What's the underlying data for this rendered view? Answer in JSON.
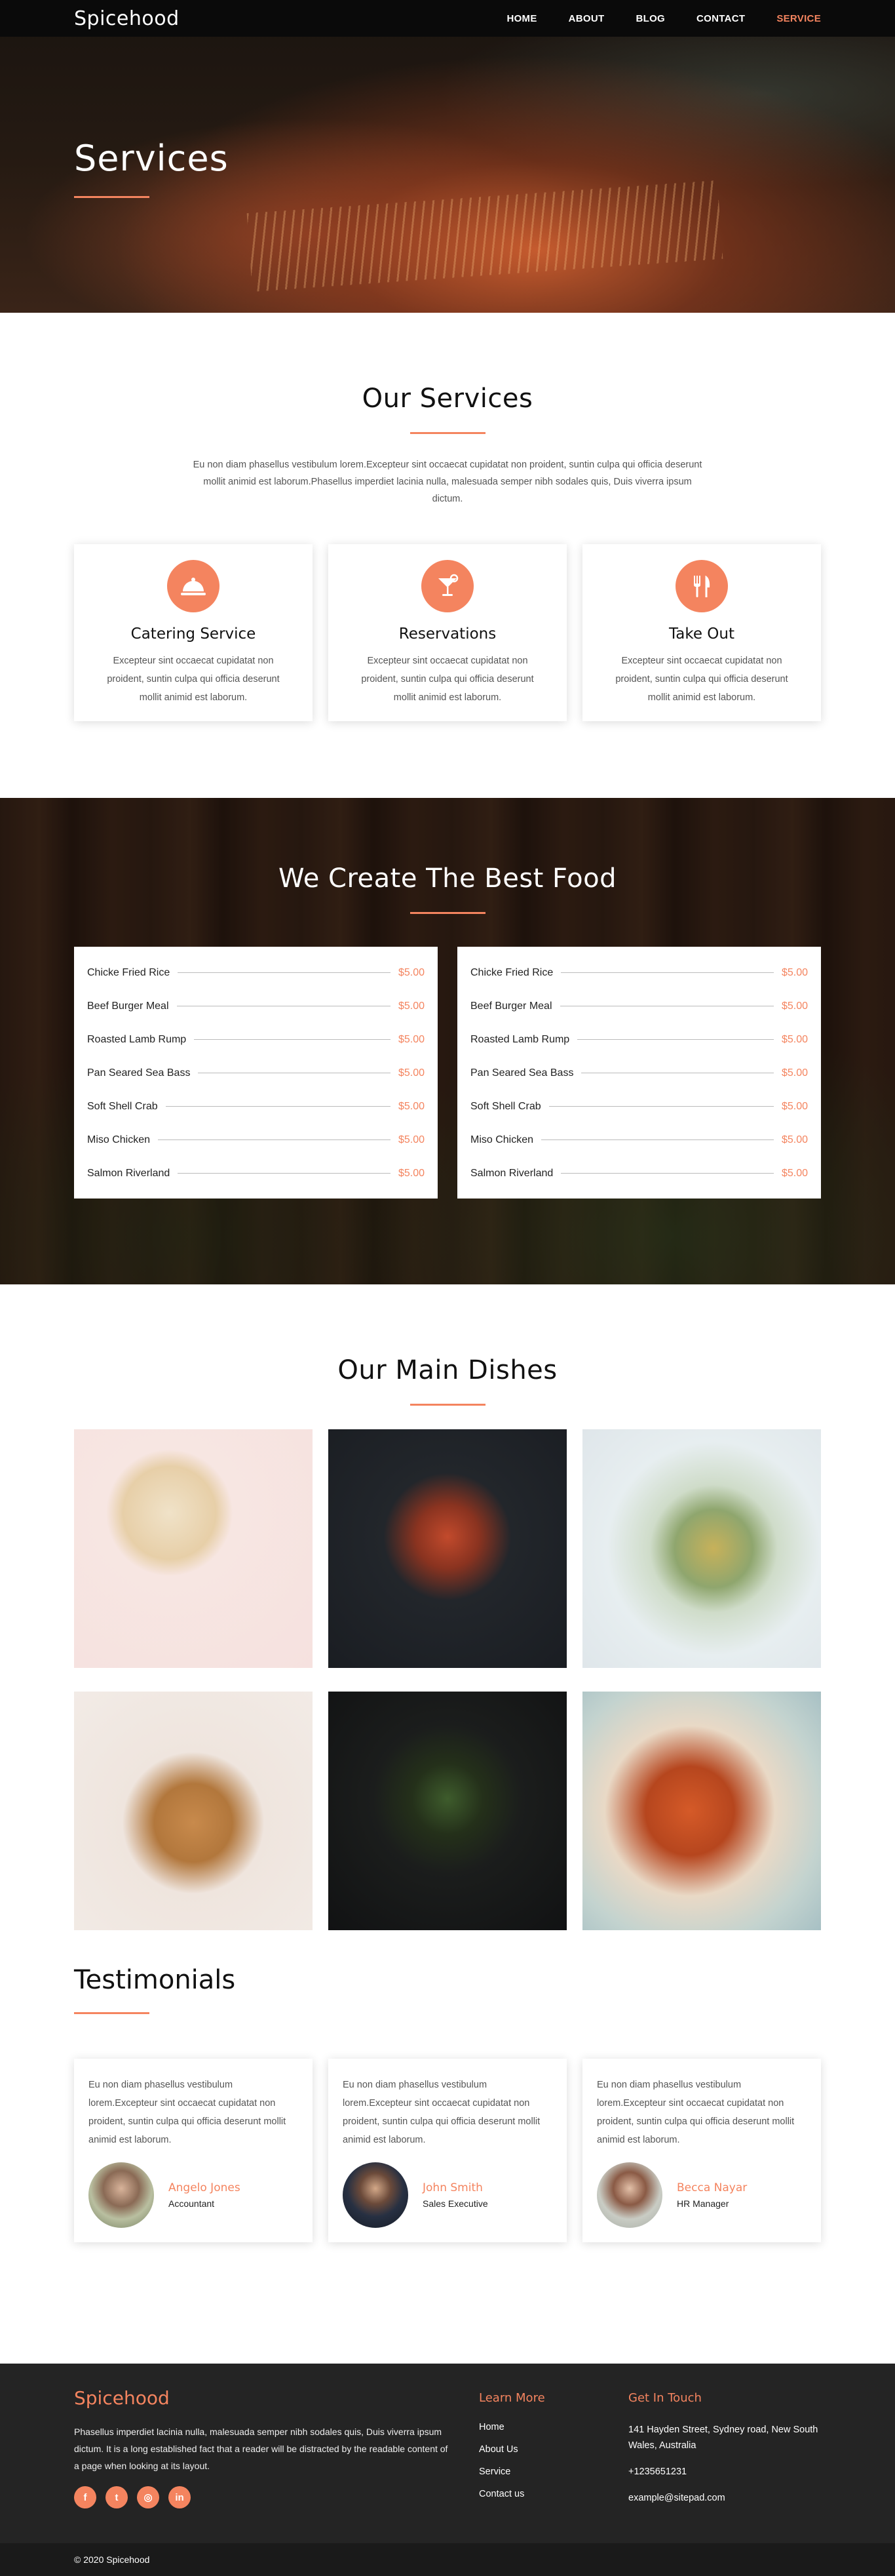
{
  "brand": "Spicehood",
  "nav": {
    "items": [
      {
        "label": "HOME",
        "active": false
      },
      {
        "label": "ABOUT",
        "active": false
      },
      {
        "label": "BLOG",
        "active": false
      },
      {
        "label": "CONTACT",
        "active": false
      },
      {
        "label": "SERVICE",
        "active": true
      }
    ]
  },
  "hero": {
    "title": "Services"
  },
  "services": {
    "title": "Our Services",
    "intro": "Eu non diam phasellus vestibulum lorem.Excepteur sint occaecat cupidatat non proident, suntin culpa qui officia deserunt mollit animid est laborum.Phasellus imperdiet lacinia nulla, malesuada semper nibh sodales quis, Duis viverra ipsum dictum.",
    "cards": [
      {
        "icon": "cloche-icon",
        "title": "Catering Service",
        "text": "Excepteur sint occaecat cupidatat non proident, suntin culpa qui officia deserunt mollit animid est laborum."
      },
      {
        "icon": "cocktail-icon",
        "title": "Reservations",
        "text": "Excepteur sint occaecat cupidatat non proident, suntin culpa qui officia deserunt mollit animid est laborum."
      },
      {
        "icon": "fork-knife-icon",
        "title": "Take Out",
        "text": "Excepteur sint occaecat cupidatat non proident, suntin culpa qui officia deserunt mollit animid est laborum."
      }
    ]
  },
  "food": {
    "title": "We Create The Best Food",
    "menus": [
      [
        {
          "name": "Chicke Fried Rice",
          "price": "$5.00"
        },
        {
          "name": "Beef Burger Meal",
          "price": "$5.00"
        },
        {
          "name": "Roasted Lamb Rump",
          "price": "$5.00"
        },
        {
          "name": "Pan Seared Sea Bass",
          "price": "$5.00"
        },
        {
          "name": "Soft Shell Crab",
          "price": "$5.00"
        },
        {
          "name": "Miso Chicken",
          "price": "$5.00"
        },
        {
          "name": "Salmon Riverland",
          "price": "$5.00"
        }
      ],
      [
        {
          "name": "Chicke Fried Rice",
          "price": "$5.00"
        },
        {
          "name": "Beef Burger Meal",
          "price": "$5.00"
        },
        {
          "name": "Roasted Lamb Rump",
          "price": "$5.00"
        },
        {
          "name": "Pan Seared Sea Bass",
          "price": "$5.00"
        },
        {
          "name": "Soft Shell Crab",
          "price": "$5.00"
        },
        {
          "name": "Miso Chicken",
          "price": "$5.00"
        },
        {
          "name": "Salmon Riverland",
          "price": "$5.00"
        }
      ]
    ]
  },
  "dishes": {
    "title": "Our Main Dishes"
  },
  "testimonials": {
    "title": "Testimonials",
    "items": [
      {
        "quote": "Eu non diam phasellus vestibulum lorem.Excepteur sint occaecat cupidatat non proident, suntin culpa qui officia deserunt mollit animid est laborum.",
        "name": "Angelo Jones",
        "role": "Accountant"
      },
      {
        "quote": "Eu non diam phasellus vestibulum lorem.Excepteur sint occaecat cupidatat non proident, suntin culpa qui officia deserunt mollit animid est laborum.",
        "name": "John Smith",
        "role": "Sales Executive"
      },
      {
        "quote": "Eu non diam phasellus vestibulum lorem.Excepteur sint occaecat cupidatat non proident, suntin culpa qui officia deserunt mollit animid est laborum.",
        "name": "Becca Nayar",
        "role": "HR Manager"
      }
    ]
  },
  "footer": {
    "brand": "Spicehood",
    "text": "Phasellus imperdiet lacinia nulla, malesuada semper nibh sodales quis, Duis viverra ipsum dictum. It is a long established fact that a reader will be distracted by the readable content of a page when looking at its layout.",
    "socials": [
      {
        "icon": "facebook-icon",
        "glyph": "f"
      },
      {
        "icon": "twitter-icon",
        "glyph": "t"
      },
      {
        "icon": "instagram-icon",
        "glyph": "◎"
      },
      {
        "icon": "linkedin-icon",
        "glyph": "in"
      }
    ],
    "learn_more": {
      "title": "Learn More",
      "links": [
        "Home",
        "About Us",
        "Service",
        "Contact us"
      ]
    },
    "contact": {
      "title": "Get In Touch",
      "address": "141 Hayden Street, Sydney road, New South Wales, Australia",
      "phone": "+1235651231",
      "email": "example@sitepad.com"
    },
    "copyright": "© 2020 Spicehood"
  },
  "colors": {
    "accent": "#f4845f",
    "dark": "#242424",
    "nav": "#0a0a0a"
  }
}
